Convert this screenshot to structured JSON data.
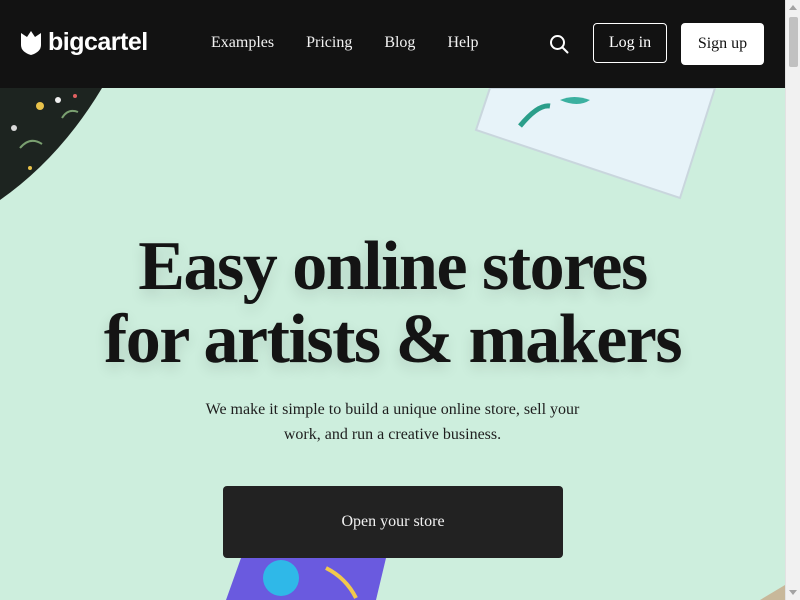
{
  "header": {
    "logo_text": "bigcartel",
    "nav": [
      "Examples",
      "Pricing",
      "Blog",
      "Help"
    ],
    "login_label": "Log in",
    "signup_label": "Sign up"
  },
  "hero": {
    "title_line1": "Easy online stores",
    "title_line2": "for artists & makers",
    "subtitle": "We make it simple to build a unique online store, sell your work, and run a creative business.",
    "cta_label": "Open your store"
  },
  "colors": {
    "header_bg": "#121212",
    "hero_bg": "#cdeedd",
    "cta_bg": "#222222"
  }
}
